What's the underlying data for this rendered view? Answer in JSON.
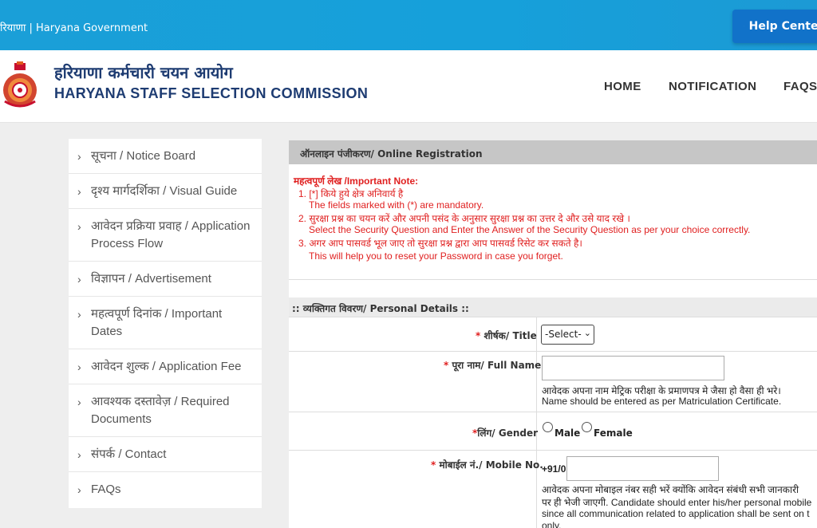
{
  "topbar": {
    "text": "रियाणा | Haryana Government",
    "help_label": "Help Center:"
  },
  "header": {
    "org_hindi": "हरियाणा कर्मचारी चयन आयोग",
    "org_english": "HARYANA STAFF SELECTION COMMISSION",
    "nav": [
      "HOME",
      "NOTIFICATION",
      "FAQS"
    ]
  },
  "sidebar": {
    "items": [
      {
        "line1": "सूचना / Notice Board",
        "line2": ""
      },
      {
        "line1": "दृश्य मार्गदर्शिका / Visual Guide",
        "line2": ""
      },
      {
        "line1": "आवेदन प्रक्रिया प्रवाह / Application",
        "line2": "Process Flow"
      },
      {
        "line1": "विज्ञापन / Advertisement",
        "line2": ""
      },
      {
        "line1": "महत्वपूर्ण दिनांक / Important",
        "line2": "Dates"
      },
      {
        "line1": "आवेदन शुल्क / Application Fee",
        "line2": ""
      },
      {
        "line1": "आवश्यक दस्तावेज़ / Required",
        "line2": "Documents"
      },
      {
        "line1": "संपर्क / Contact",
        "line2": ""
      },
      {
        "line1": "FAQs",
        "line2": ""
      }
    ]
  },
  "main": {
    "panel_title": "ऑनलाइन पंजीकरण/ Online Registration",
    "note_title": "महत्वपूर्ण लेख /Important Note:",
    "notes": [
      "1. [*] किये हुये क्षेत्र अनिवार्य है",
      "The fields marked with (*) are mandatory.",
      "2. सुरक्षा प्रश्न का चयन करें और अपनी पसंद के अनुसार सुरक्षा प्रश्न का उत्तर दे और उसे याद रखे ।",
      "Select the Security Question and Enter the Answer of the Security Question as per your choice correctly.",
      "3. अगर आप पासवर्ड भूल जाए तो सुरक्षा प्रश्न द्वारा आप पासवर्ड रिसेट कर सकते है।",
      "This will help you to reset your Password in case you forget."
    ],
    "personal_head": ":: व्यक्तिगत विवरण/ Personal Details ::",
    "required_mark": "*",
    "title_label": " शीर्षक/ Title",
    "title_value": "-Select-",
    "name_label": " पूरा नाम/ Full Name",
    "name_hint_1": "आवेदक अपना नाम मेट्रिक परीक्षा के प्रमाणपत्र मे जैसा हो वैसा ही भरे।",
    "name_hint_2": "Name should be entered as per Matriculation Certificate.",
    "gender_label": "लिंग/ Gender",
    "gender_options": [
      "Male",
      "Female"
    ],
    "mobile_label": " मोबाईल नं./ Mobile No.",
    "mobile_prefix": "+91/0",
    "mobile_hint_1": "आवेदक अपना मोबाइल नंबर सही भरें क्योंकि आवेदन संबंधी सभी जानकारी",
    "mobile_hint_2": "पर ही भेजी जाएगी. Candidate should enter his/her personal mobile",
    "mobile_hint_3": "since all communication related to application shall be sent on t",
    "mobile_hint_4": "only."
  }
}
